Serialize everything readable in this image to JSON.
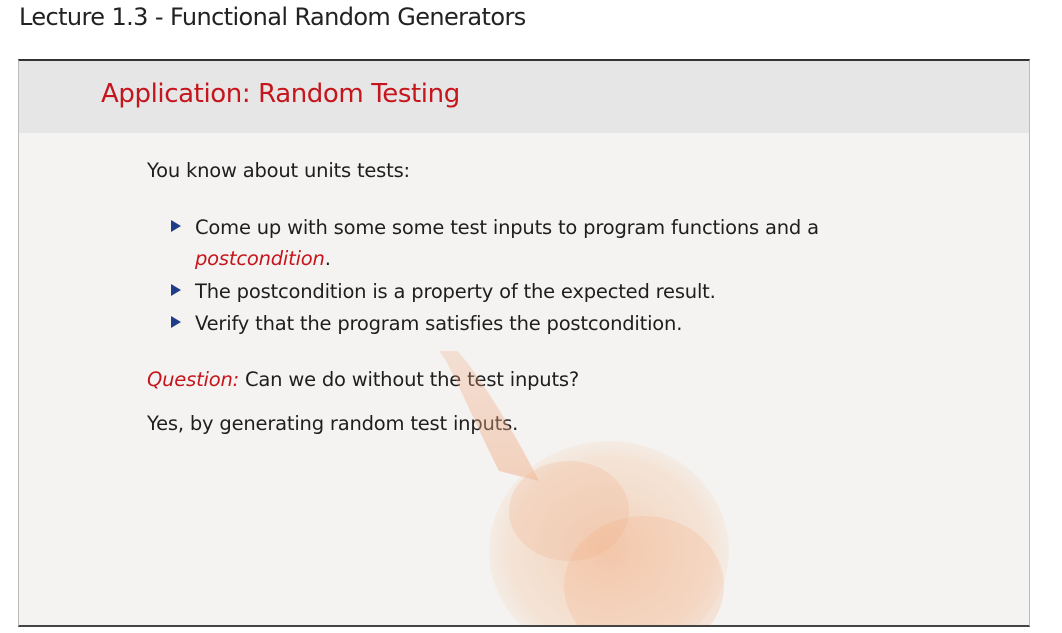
{
  "page": {
    "title": "Lecture 1.3 - Functional Random Generators"
  },
  "slide": {
    "title": "Application: Random Testing",
    "intro": "You know about units tests:",
    "bullets": [
      {
        "text": "Come up with some some test inputs to program functions and a",
        "continuation_emph": "postcondition",
        "continuation_tail": "."
      },
      {
        "text": "The postcondition is a property of the expected result."
      },
      {
        "text": "Verify that the program satisfies the postcondition."
      }
    ],
    "question_label": "Question:",
    "question_text": "Can we do without the test inputs?",
    "answer": "Yes, by generating random test inputs."
  },
  "colors": {
    "accent_red": "#c4161c",
    "bullet_blue": "#1f3c88",
    "header_gray": "#e6e6e6",
    "slide_bg": "#f4f3f1"
  },
  "icons": {
    "bullet": "triangle-bullet-icon",
    "pointer": "pointing-hand-icon"
  }
}
